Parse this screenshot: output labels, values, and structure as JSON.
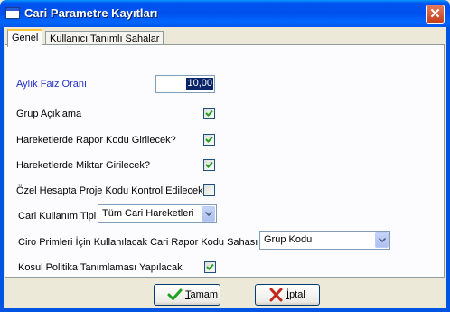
{
  "window": {
    "title": "Cari Parametre Kayıtları",
    "close_glyph": "✕"
  },
  "tabs": [
    {
      "label": "Genel",
      "active": true
    },
    {
      "label": "Kullanıcı Tanımlı Sahalar",
      "active": false
    }
  ],
  "form": {
    "faiz": {
      "label": "Aylık Faiz Oranı",
      "value": "10,00"
    },
    "grup_aciklama": {
      "label": "Grup Açıklama",
      "checked": true
    },
    "rapor_kodu": {
      "label": "Hareketlerde Rapor Kodu Girilecek?",
      "checked": true
    },
    "miktar": {
      "label": "Hareketlerde Miktar Girilecek?",
      "checked": true
    },
    "proje_kodu": {
      "label": "Özel Hesapta Proje Kodu Kontrol Edilecek",
      "checked": false
    },
    "cari_kullanim": {
      "label": "Cari Kullanım Tipi",
      "value": "Tüm Cari Hareketleri"
    },
    "ciro_primleri": {
      "label": "Ciro Primleri İçin Kullanılacak Cari Rapor Kodu Sahası",
      "value": "Grup Kodu"
    },
    "kosul_politika": {
      "label": "Kosul Politika Tanımlaması Yapılacak",
      "checked": true
    }
  },
  "buttons": {
    "ok": {
      "mnemonic": "T",
      "rest": "amam",
      "icon": "check-icon"
    },
    "cancel": {
      "mnemonic": "İ",
      "rest": "ptal",
      "icon": "cross-icon"
    }
  },
  "colors": {
    "title_bar": "#0054E3",
    "blue_label": "#2330C8",
    "check": "#21A121",
    "cancel_x": "#C1281B"
  }
}
